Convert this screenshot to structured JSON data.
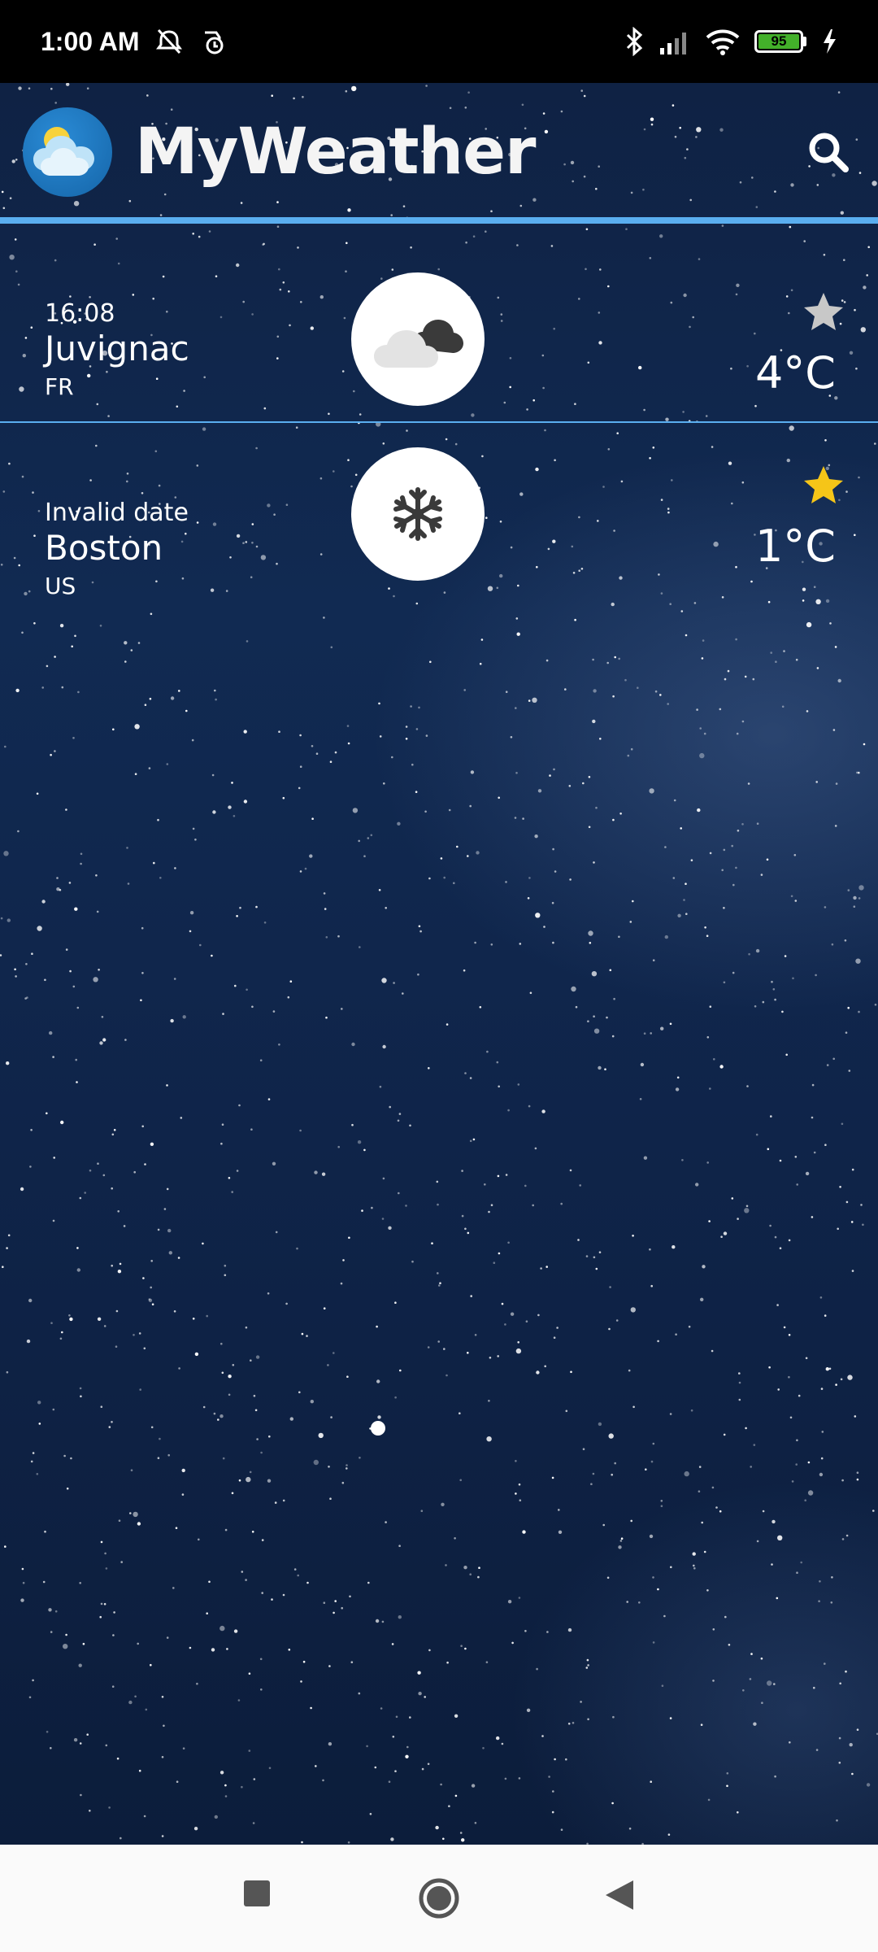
{
  "status_bar": {
    "time": "1:00 AM",
    "icons": [
      "alarm-off-icon",
      "clock-icon",
      "bluetooth-icon",
      "signal-icon",
      "wifi-icon",
      "battery-icon",
      "charging-icon"
    ],
    "battery_level": "95"
  },
  "app_bar": {
    "title": "MyWeather",
    "logo_icon": "partly-cloudy-logo-icon",
    "search_icon": "search-icon",
    "divider_color": "#5aaef0"
  },
  "cities": [
    {
      "time": "16:08",
      "name": "Juvignac",
      "country": "FR",
      "weather_icon": "cloudy-icon",
      "favorite": false,
      "temperature": "4°C"
    },
    {
      "time": "Invalid date",
      "name": "Boston",
      "country": "US",
      "weather_icon": "snowflake-icon",
      "favorite": true,
      "temperature": "1°C"
    }
  ],
  "colors": {
    "accent": "#5aaef0",
    "favorite_on": "#f5c518",
    "favorite_off": "#c8c8c8"
  },
  "nav_bar": {
    "buttons": [
      "recents-button",
      "home-button",
      "back-button"
    ]
  }
}
